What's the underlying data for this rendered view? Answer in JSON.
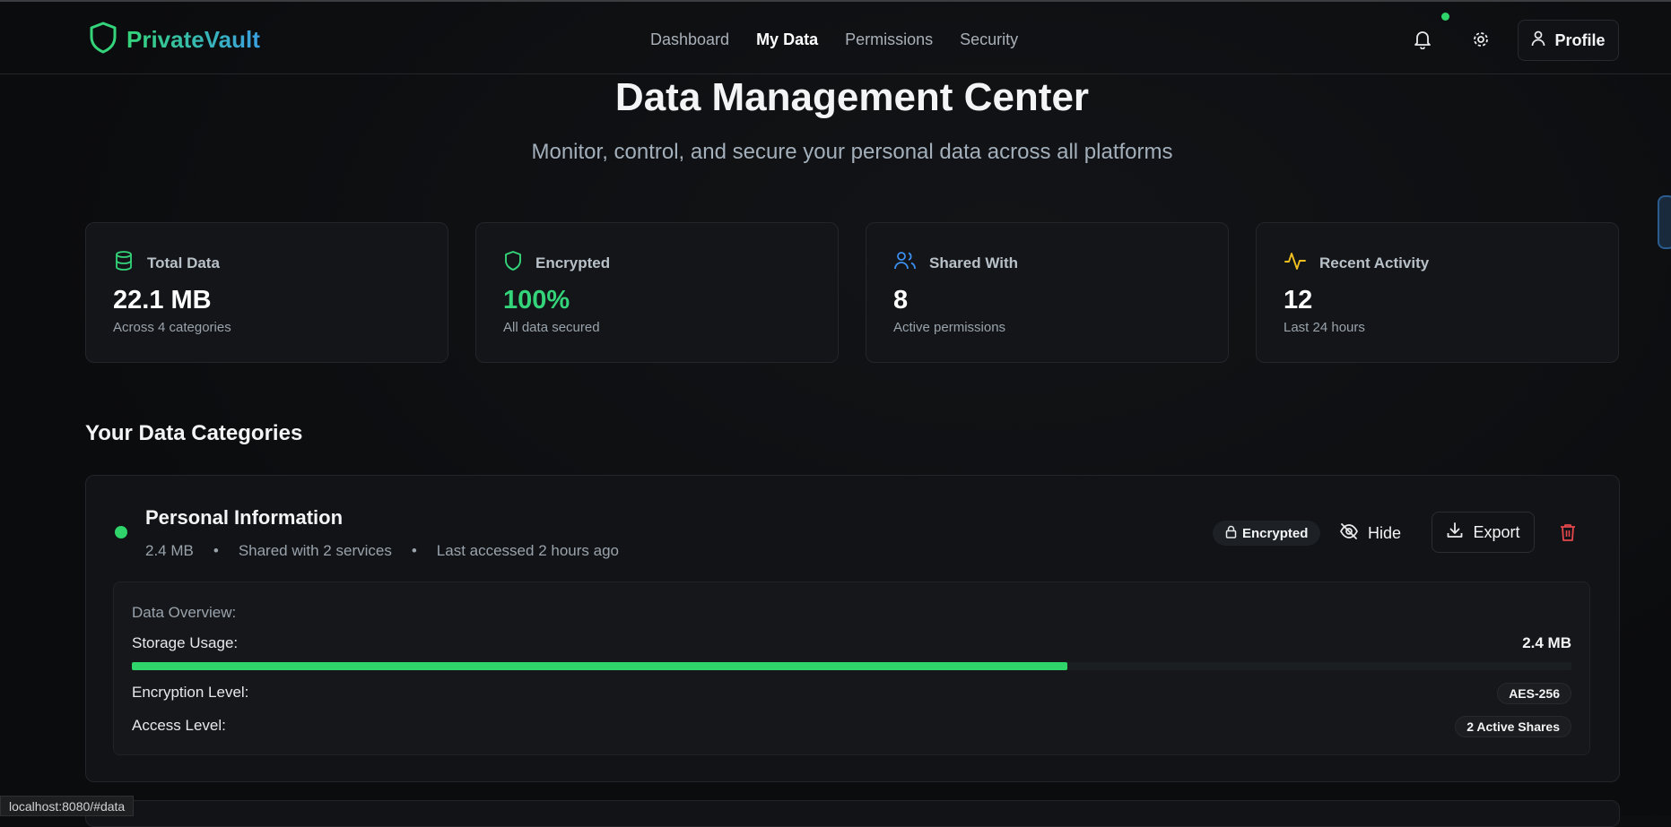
{
  "brand": {
    "name": "PrivateVault",
    "accent": "#34d47a",
    "accent2": "#3aa0e0"
  },
  "nav": [
    {
      "label": "Dashboard",
      "active": false
    },
    {
      "label": "My Data",
      "active": true
    },
    {
      "label": "Permissions",
      "active": false
    },
    {
      "label": "Security",
      "active": false
    }
  ],
  "header": {
    "profile_label": "Profile",
    "icons": [
      "bell-icon",
      "gear-icon",
      "user-icon"
    ]
  },
  "page": {
    "title": "Data Management Center",
    "subtitle": "Monitor, control, and secure your personal data across all platforms"
  },
  "stats": [
    {
      "label": "Total Data",
      "value": "22.1 MB",
      "note": "Across 4 categories",
      "icon": "database-icon",
      "color": "#34d47a"
    },
    {
      "label": "Encrypted",
      "value": "100%",
      "note": "All data secured",
      "icon": "shield-icon",
      "color": "#34d47a"
    },
    {
      "label": "Shared With",
      "value": "8",
      "note": "Active permissions",
      "icon": "users-icon",
      "color": "#3b8ff0"
    },
    {
      "label": "Recent Activity",
      "value": "12",
      "note": "Last 24 hours",
      "icon": "activity-icon",
      "color": "#f2c01f"
    }
  ],
  "section_title": "Your Data Categories",
  "category": {
    "name": "Personal Information",
    "size": "2.4 MB",
    "shared": "Shared with 2 services",
    "last_accessed": "Last accessed 2 hours ago",
    "separator": "•",
    "encrypted_badge": "Encrypted",
    "hide_label": "Hide",
    "export_label": "Export",
    "overview": {
      "title": "Data Overview:",
      "storage_label": "Storage Usage:",
      "storage_value": "2.4 MB",
      "storage_fraction": 0.65,
      "encryption_label": "Encryption Level:",
      "encryption_value": "AES-256",
      "access_label": "Access Level:",
      "access_value": "2 Active Shares"
    }
  },
  "status_url": "localhost:8080/#data"
}
